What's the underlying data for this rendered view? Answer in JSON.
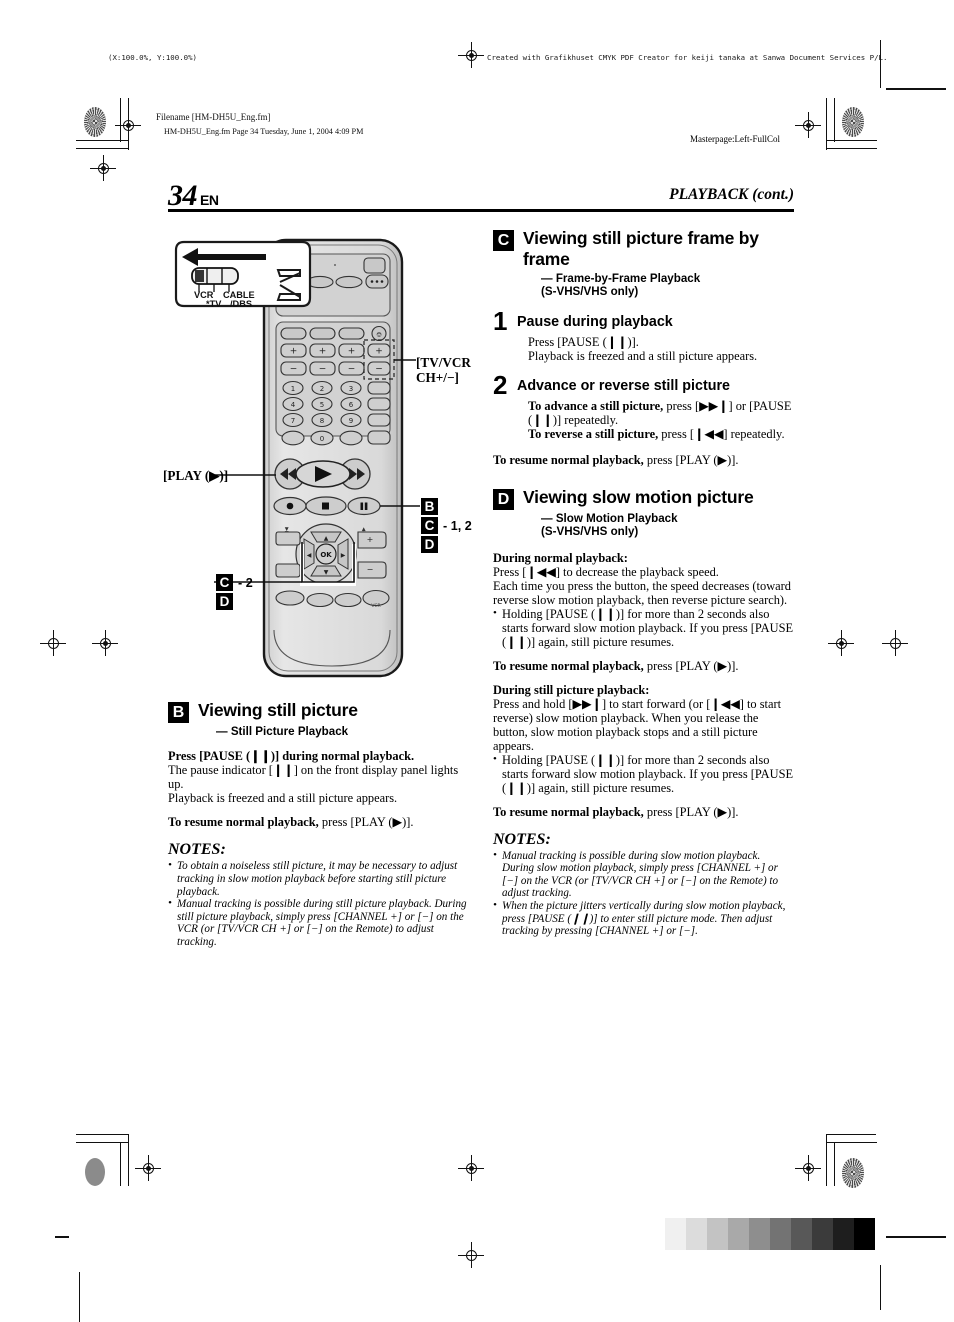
{
  "print_marks": {
    "scale_note": "(X:100.0%, Y:100.0%)",
    "creator_note": "Created with Grafikhuset CMYK PDF Creator for keiji tanaka at Sanwa Document Services P/L.",
    "filename_label": "Filename [HM-DH5U_Eng.fm]",
    "file_stamp": "HM-DH5U_Eng.fm  Page 34  Tuesday, June 1, 2004  4:09 PM",
    "masterpage": "Masterpage:Left-FullCol"
  },
  "header": {
    "page_number": "34",
    "language_code": "EN",
    "chapter_title": "PLAYBACK (cont.)"
  },
  "remote": {
    "mode_switch": {
      "positions": [
        "VCR",
        "*TV",
        "CABLE",
        "/DBS"
      ]
    },
    "callouts": {
      "tv_vcr_ch": "[TV/VCR\nCH+/−]",
      "play": "[PLAY (▶)]",
      "group_right": [
        {
          "badge": "B",
          "suffix": ""
        },
        {
          "badge": "C",
          "suffix": "- 1, 2"
        },
        {
          "badge": "D",
          "suffix": ""
        }
      ],
      "group_left": [
        {
          "badge": "C",
          "suffix": "- 2"
        },
        {
          "badge": "D",
          "suffix": ""
        }
      ]
    },
    "keypad_digits": [
      "1",
      "2",
      "3",
      "4",
      "5",
      "6",
      "7",
      "8",
      "9",
      "0"
    ],
    "ok_label": "OK"
  },
  "section_b": {
    "badge": "B",
    "title": "Viewing still picture",
    "subtitle": "— Still Picture Playback",
    "paragraphs": [
      {
        "bold_lead": "Press [PAUSE (❙❙)] during normal playback.",
        "rest": ""
      },
      {
        "bold_lead": "",
        "rest": "The pause indicator [❙❙] on the front display panel lights up."
      },
      {
        "bold_lead": "",
        "rest": "Playback is freezed and a still picture appears."
      }
    ],
    "resume": {
      "bold_lead": "To resume normal playback,",
      "rest": " press [PLAY (▶)]."
    },
    "notes_title": "NOTES:",
    "notes": [
      "To obtain a noiseless still picture, it may be necessary to adjust tracking in slow motion playback before starting still picture playback.",
      "Manual tracking is possible during still picture playback. During still picture playback, simply press [CHANNEL +] or [−] on the VCR (or [TV/VCR CH +] or [−] on the Remote) to adjust tracking."
    ]
  },
  "section_c": {
    "badge": "C",
    "title": "Viewing still picture frame by frame",
    "subtitle": "— Frame-by-Frame Playback\n   (S-VHS/VHS only)",
    "steps": [
      {
        "number": "1",
        "title": "Pause during playback",
        "lines": [
          {
            "bold_lead": "",
            "rest": "Press [PAUSE (❙❙)]."
          },
          {
            "bold_lead": "",
            "rest": "Playback is freezed and a still picture appears."
          }
        ]
      },
      {
        "number": "2",
        "title": "Advance or reverse still picture",
        "lines": [
          {
            "bold_lead": "To advance a still picture,",
            "rest": " press [▶▶❙] or [PAUSE (❙❙)] repeatedly."
          },
          {
            "bold_lead": "To reverse a still picture,",
            "rest": " press [❙◀◀] repeatedly."
          }
        ]
      }
    ],
    "resume": {
      "bold_lead": "To resume normal playback,",
      "rest": " press [PLAY (▶)]."
    }
  },
  "section_d": {
    "badge": "D",
    "title": "Viewing slow motion picture",
    "subtitle": "— Slow Motion Playback\n   (S-VHS/VHS only)",
    "block1": {
      "heading": "During normal playback:",
      "lines": [
        "Press [❙◀◀] to decrease the playback speed.",
        "Each time you press the button, the speed decreases (toward reverse slow motion playback, then reverse picture search)."
      ],
      "bullets": [
        "Holding [PAUSE (❙❙)] for more than 2 seconds also starts forward slow motion playback. If you press [PAUSE (❙❙)] again, still picture resumes."
      ],
      "resume": {
        "bold_lead": "To resume normal playback,",
        "rest": " press [PLAY (▶)]."
      }
    },
    "block2": {
      "heading": "During still picture playback:",
      "lines": [
        "Press and hold [▶▶❙] to start forward (or [❙◀◀] to start reverse) slow motion playback. When you release the button, slow motion playback stops and a still picture appears."
      ],
      "bullets": [
        "Holding [PAUSE (❙❙)] for more than 2 seconds also starts forward slow motion playback. If you press [PAUSE (❙❙)] again, still picture resumes."
      ],
      "resume": {
        "bold_lead": "To resume normal playback,",
        "rest": " press [PLAY (▶)]."
      }
    },
    "notes_title": "NOTES:",
    "notes": [
      "Manual tracking is possible during slow motion playback. During slow motion playback, simply press [CHANNEL +] or [−] on the VCR (or [TV/VCR CH +] or [−] on the Remote) to adjust tracking.",
      "When the picture jitters vertically during slow motion playback, press [PAUSE (❙❙)] to enter still picture mode. Then adjust tracking by pressing [CHANNEL +] or [−]."
    ]
  },
  "grey_wedge": [
    "#f0f0f0",
    "#dcdcdc",
    "#c3c3c3",
    "#a9a9a9",
    "#8e8e8e",
    "#737373",
    "#585858",
    "#3b3b3b",
    "#1e1e1e",
    "#000000"
  ]
}
